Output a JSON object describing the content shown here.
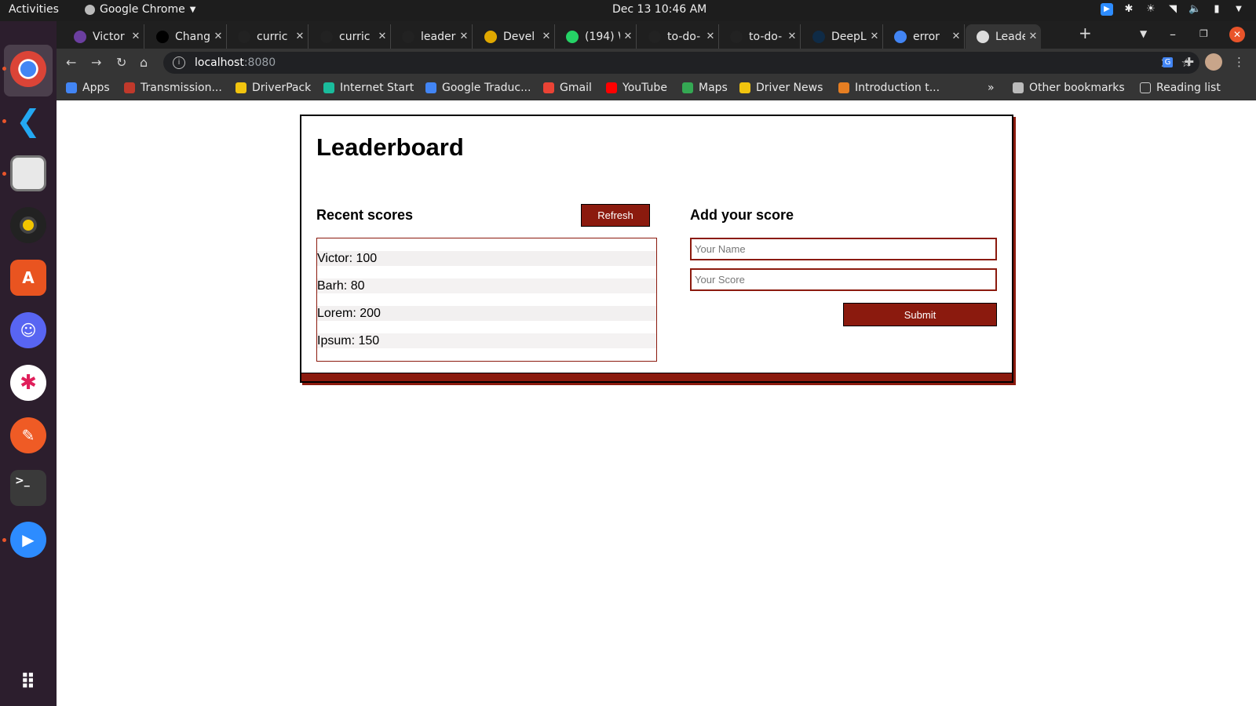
{
  "system": {
    "activities": "Activities",
    "app_name": "Google Chrome",
    "clock": "Dec 13  10:46 AM"
  },
  "tabs": [
    {
      "title": "Victor",
      "icon": "app-icon",
      "color": "#6b3fa0"
    },
    {
      "title": "Chang",
      "icon": "github-icon",
      "color": "#000000"
    },
    {
      "title": "curric",
      "icon": "github-icon",
      "color": "#222222"
    },
    {
      "title": "curric",
      "icon": "github-icon",
      "color": "#222222"
    },
    {
      "title": "leader",
      "icon": "github-icon",
      "color": "#222222"
    },
    {
      "title": "Devel",
      "icon": "devel-icon",
      "color": "#e0a800"
    },
    {
      "title": "(194) W",
      "icon": "whatsapp-icon",
      "color": "#25d366"
    },
    {
      "title": "to-do-",
      "icon": "github-icon",
      "color": "#222222"
    },
    {
      "title": "to-do-",
      "icon": "github-icon",
      "color": "#222222"
    },
    {
      "title": "DeepL",
      "icon": "deepl-icon",
      "color": "#0f2b46"
    },
    {
      "title": "error",
      "icon": "google-icon",
      "color": "#4285f4"
    },
    {
      "title": "Leade",
      "icon": "globe-icon",
      "color": "#dddddd",
      "active": true
    }
  ],
  "address": {
    "host": "localhost",
    "port": ":8080"
  },
  "bookmarks": [
    {
      "label": "Apps",
      "icon": "apps-grid-icon",
      "color": "#4285f4"
    },
    {
      "label": "Transmission...",
      "icon": "transmission-icon",
      "color": "#c0392b"
    },
    {
      "label": "DriverPack",
      "icon": "driverpack-icon",
      "color": "#f1c40f"
    },
    {
      "label": "Internet Start",
      "icon": "internet-start-icon",
      "color": "#1abc9c"
    },
    {
      "label": "Google Traduc...",
      "icon": "translate-icon",
      "color": "#4285f4"
    },
    {
      "label": "Gmail",
      "icon": "gmail-icon",
      "color": "#ea4335"
    },
    {
      "label": "YouTube",
      "icon": "youtube-icon",
      "color": "#ff0000"
    },
    {
      "label": "Maps",
      "icon": "maps-icon",
      "color": "#34a853"
    },
    {
      "label": "Driver News",
      "icon": "driverpack-icon",
      "color": "#f1c40f"
    },
    {
      "label": "Introduction t...",
      "icon": "intro-icon",
      "color": "#e67e22"
    }
  ],
  "bookmarks_right": {
    "other": "Other bookmarks",
    "reading": "Reading list"
  },
  "page": {
    "title": "Leaderboard",
    "recent_title": "Recent scores",
    "refresh_label": "Refresh",
    "scores": [
      {
        "text": "Victor: 100"
      },
      {
        "text": "Barh: 80"
      },
      {
        "text": "Lorem: 200"
      },
      {
        "text": "Ipsum: 150"
      }
    ],
    "add_title": "Add your score",
    "name_placeholder": "Your Name",
    "score_placeholder": "Your Score",
    "submit_label": "Submit",
    "accent_color": "#8b1a0e"
  }
}
